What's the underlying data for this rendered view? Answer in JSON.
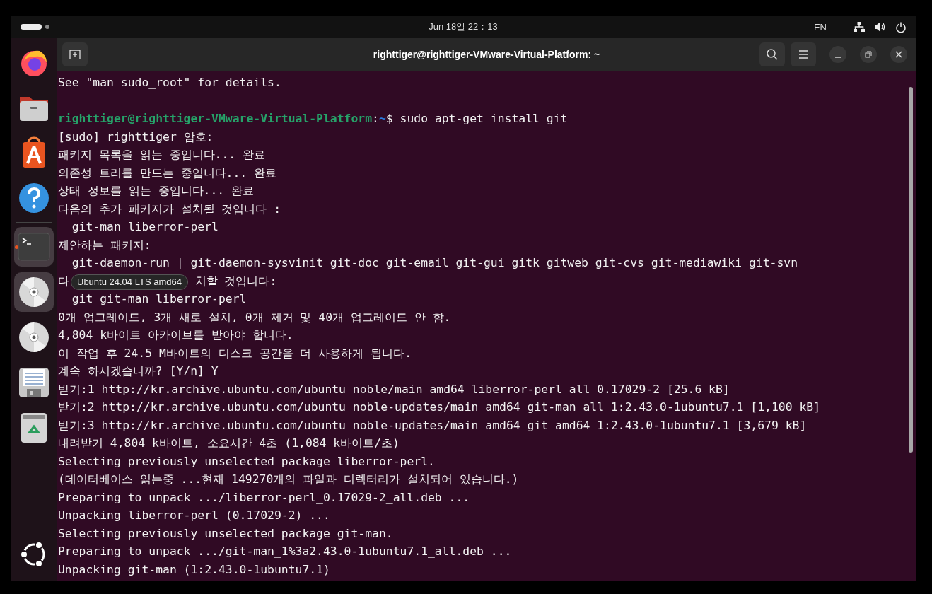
{
  "top_bar": {
    "clock": "Jun 18일 22：13",
    "input_method": "EN"
  },
  "dock": {
    "items": [
      {
        "kind": "firefox",
        "running": false,
        "highlighted": false
      },
      {
        "kind": "files",
        "running": false,
        "highlighted": false
      },
      {
        "kind": "app-center",
        "running": false,
        "highlighted": false
      },
      {
        "kind": "help",
        "running": false,
        "highlighted": false
      },
      {
        "kind": "separator"
      },
      {
        "kind": "terminal",
        "running": true,
        "highlighted": true
      },
      {
        "kind": "disc",
        "running": false,
        "highlighted": true
      },
      {
        "kind": "disc",
        "running": false,
        "highlighted": false
      },
      {
        "kind": "editor",
        "running": false,
        "highlighted": false
      },
      {
        "kind": "trash",
        "running": false,
        "highlighted": false
      }
    ],
    "tooltip": "Ubuntu 24.04 LTS amd64"
  },
  "window": {
    "title": "righttiger@righttiger-VMware-Virtual-Platform: ~"
  },
  "terminal": {
    "lines": [
      {
        "kind": "text",
        "text": "See \"man sudo_root\" for details."
      },
      {
        "kind": "blank"
      },
      {
        "kind": "prompt",
        "user": "righttiger@righttiger-VMware-Virtual-Platform",
        "separator": ":",
        "path": "~",
        "command": "$ sudo apt-get install git"
      },
      {
        "kind": "text",
        "text": "[sudo] righttiger 암호:"
      },
      {
        "kind": "text",
        "text": "패키지 목록을 읽는 중입니다... 완료"
      },
      {
        "kind": "text",
        "text": "의존성 트리를 만드는 중입니다... 완료"
      },
      {
        "kind": "text",
        "text": "상태 정보를 읽는 중입니다... 완료"
      },
      {
        "kind": "text",
        "text": "다음의 추가 패키지가 설치될 것입니다 :"
      },
      {
        "kind": "text",
        "text": "  git-man liberror-perl"
      },
      {
        "kind": "text",
        "text": "제안하는 패키지:"
      },
      {
        "kind": "text",
        "text": "  git-daemon-run | git-daemon-sysvinit git-doc git-email git-gui gitk gitweb git-cvs git-mediawiki git-svn"
      },
      {
        "kind": "covered",
        "text": "다",
        "rest": "치할 것입니다:"
      },
      {
        "kind": "text",
        "text": "  git git-man liberror-perl"
      },
      {
        "kind": "text",
        "text": "0개 업그레이드, 3개 새로 설치, 0개 제거 및 40개 업그레이드 안 함."
      },
      {
        "kind": "text",
        "text": "4,804 k바이트 아카이브를 받아야 합니다."
      },
      {
        "kind": "text",
        "text": "이 작업 후 24.5 M바이트의 디스크 공간을 더 사용하게 됩니다."
      },
      {
        "kind": "text",
        "text": "계속 하시겠습니까? [Y/n] Y"
      },
      {
        "kind": "text",
        "text": "받기:1 http://kr.archive.ubuntu.com/ubuntu noble/main amd64 liberror-perl all 0.17029-2 [25.6 kB]"
      },
      {
        "kind": "text",
        "text": "받기:2 http://kr.archive.ubuntu.com/ubuntu noble-updates/main amd64 git-man all 1:2.43.0-1ubuntu7.1 [1,100 kB]"
      },
      {
        "kind": "text",
        "text": "받기:3 http://kr.archive.ubuntu.com/ubuntu noble-updates/main amd64 git amd64 1:2.43.0-1ubuntu7.1 [3,679 kB]"
      },
      {
        "kind": "text",
        "text": "내려받기 4,804 k바이트, 소요시간 4초 (1,084 k바이트/초)"
      },
      {
        "kind": "text",
        "text": "Selecting previously unselected package liberror-perl."
      },
      {
        "kind": "text",
        "text": "(데이터베이스 읽는중 ...현재 149270개의 파일과 디렉터리가 설치되어 있습니다.)"
      },
      {
        "kind": "text",
        "text": "Preparing to unpack .../liberror-perl_0.17029-2_all.deb ..."
      },
      {
        "kind": "text",
        "text": "Unpacking liberror-perl (0.17029-2) ..."
      },
      {
        "kind": "text",
        "text": "Selecting previously unselected package git-man."
      },
      {
        "kind": "text",
        "text": "Preparing to unpack .../git-man_1%3a2.43.0-1ubuntu7.1_all.deb ..."
      },
      {
        "kind": "text",
        "text": "Unpacking git-man (1:2.43.0-1ubuntu7.1)"
      }
    ]
  }
}
